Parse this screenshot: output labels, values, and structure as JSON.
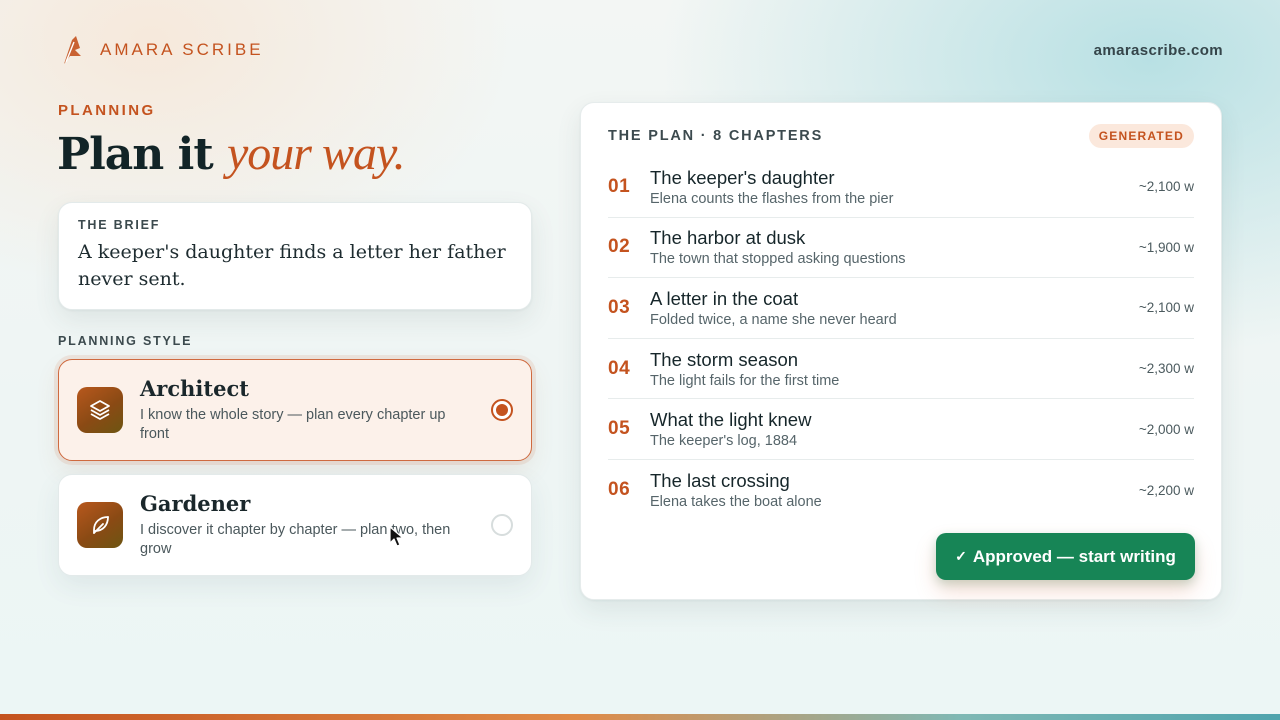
{
  "brand": {
    "name": "AMARA SCRIBE",
    "site": "amarascribe.com",
    "accent_color": "#c4531f"
  },
  "hero": {
    "eyebrow": "PLANNING",
    "headline_main": "Plan it",
    "headline_accent": "your way."
  },
  "brief": {
    "label": "THE BRIEF",
    "text": "A keeper's daughter finds a letter her father never sent."
  },
  "planning_style": {
    "label": "PLANNING STYLE",
    "options": [
      {
        "title": "Architect",
        "description": "I know the whole story — plan every chapter up front",
        "icon": "layers-icon",
        "selected": true
      },
      {
        "title": "Gardener",
        "description": "I discover it chapter by chapter — plan two, then grow",
        "icon": "feather-icon",
        "selected": false
      }
    ]
  },
  "plan": {
    "title": "THE PLAN · 8 CHAPTERS",
    "badge": "GENERATED",
    "chapters": [
      {
        "num": "01",
        "title": "The keeper's daughter",
        "subtitle": "Elena counts the flashes from the pier",
        "words": "~2,100 w"
      },
      {
        "num": "02",
        "title": "The harbor at dusk",
        "subtitle": "The town that stopped asking questions",
        "words": "~1,900 w"
      },
      {
        "num": "03",
        "title": "A letter in the coat",
        "subtitle": "Folded twice, a name she never heard",
        "words": "~2,100 w"
      },
      {
        "num": "04",
        "title": "The storm season",
        "subtitle": "The light fails for the first time",
        "words": "~2,300 w"
      },
      {
        "num": "05",
        "title": "What the light knew",
        "subtitle": "The keeper's log, 1884",
        "words": "~2,000 w"
      },
      {
        "num": "06",
        "title": "The last crossing",
        "subtitle": "Elena takes the boat alone",
        "words": "~2,200 w"
      }
    ],
    "approve_label": "Approved — start writing",
    "approve_icon": "check-icon",
    "approve_color": "#178556"
  }
}
